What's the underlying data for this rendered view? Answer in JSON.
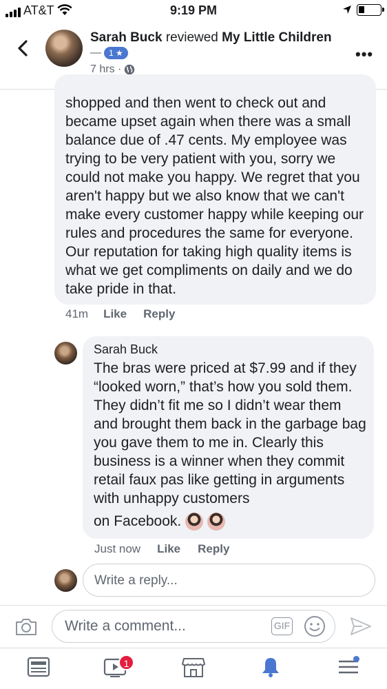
{
  "status_bar": {
    "carrier": "AT&T",
    "time": "9:19 PM"
  },
  "header": {
    "author": "Sarah Buck",
    "action": "reviewed",
    "page_name": "My Little Children",
    "rating_dash": "—",
    "rating": "1 ★",
    "time_ago": "7 hrs ·",
    "more": "•••"
  },
  "first_comment": {
    "text": "shopped and then went to check out and became upset again when there was a small balance due of .47 cents. My employee was trying to be very patient with you, sorry we could not make you happy. We regret that you aren't happy but we also know that we can't make every customer happy while keeping our rules and procedures the same for everyone. Our reputation for taking high quality items is what we get compliments on daily and we do take pride in that.",
    "time": "41m",
    "like_label": "Like",
    "reply_label": "Reply"
  },
  "reply_comment": {
    "author": "Sarah Buck",
    "text": "The bras were priced at $7.99 and if they “looked worn,” that’s how you sold them. They didn’t fit me so I didn’t wear them and brought them back in the garbage bag you gave them to me in. Clearly this business is a winner when they commit retail faux pas like getting in arguments with unhappy customers",
    "last_line": "on Facebook.",
    "time": "Just now",
    "like_label": "Like",
    "reply_label": "Reply"
  },
  "reply_input": {
    "placeholder": "Write a reply..."
  },
  "composer": {
    "placeholder": "Write a comment...",
    "gif_label": "GIF"
  },
  "tab_bar": {
    "watch_badge": "1"
  },
  "colors": {
    "accent": "#4a78d0",
    "badge": "#e41e3f",
    "bubble": "#f0f2f5",
    "muted": "#606770"
  }
}
